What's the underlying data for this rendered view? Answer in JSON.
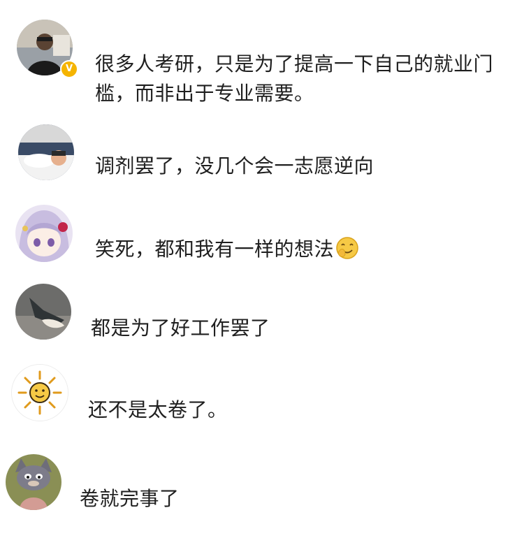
{
  "comments": [
    {
      "id": "c1",
      "avatar_icon": "man-portrait-avatar",
      "verified_badge": "V",
      "line1": "很多人考研，只是为了提高一下自己的就业门",
      "line2": "槛，而非出于专业需要。"
    },
    {
      "id": "c2",
      "avatar_icon": "sleeping-person-avatar",
      "text": "调剂罢了，没几个会一志愿逆向"
    },
    {
      "id": "c3",
      "avatar_icon": "anime-girl-avatar",
      "text": "笑死，都和我有一样的想法",
      "emoji_icon": "facepalm-smile-emoji"
    },
    {
      "id": "c4",
      "avatar_icon": "slipper-photo-avatar",
      "text": "都是为了好工作罢了"
    },
    {
      "id": "c5",
      "avatar_icon": "sun-doodle-avatar",
      "text": "还不是太卷了。"
    },
    {
      "id": "c6",
      "avatar_icon": "cartoon-cat-avatar",
      "text": "卷就完事了"
    }
  ],
  "colors": {
    "text": "#1f1f1f",
    "verified": "#f5b400",
    "emoji": "#f6c945"
  }
}
